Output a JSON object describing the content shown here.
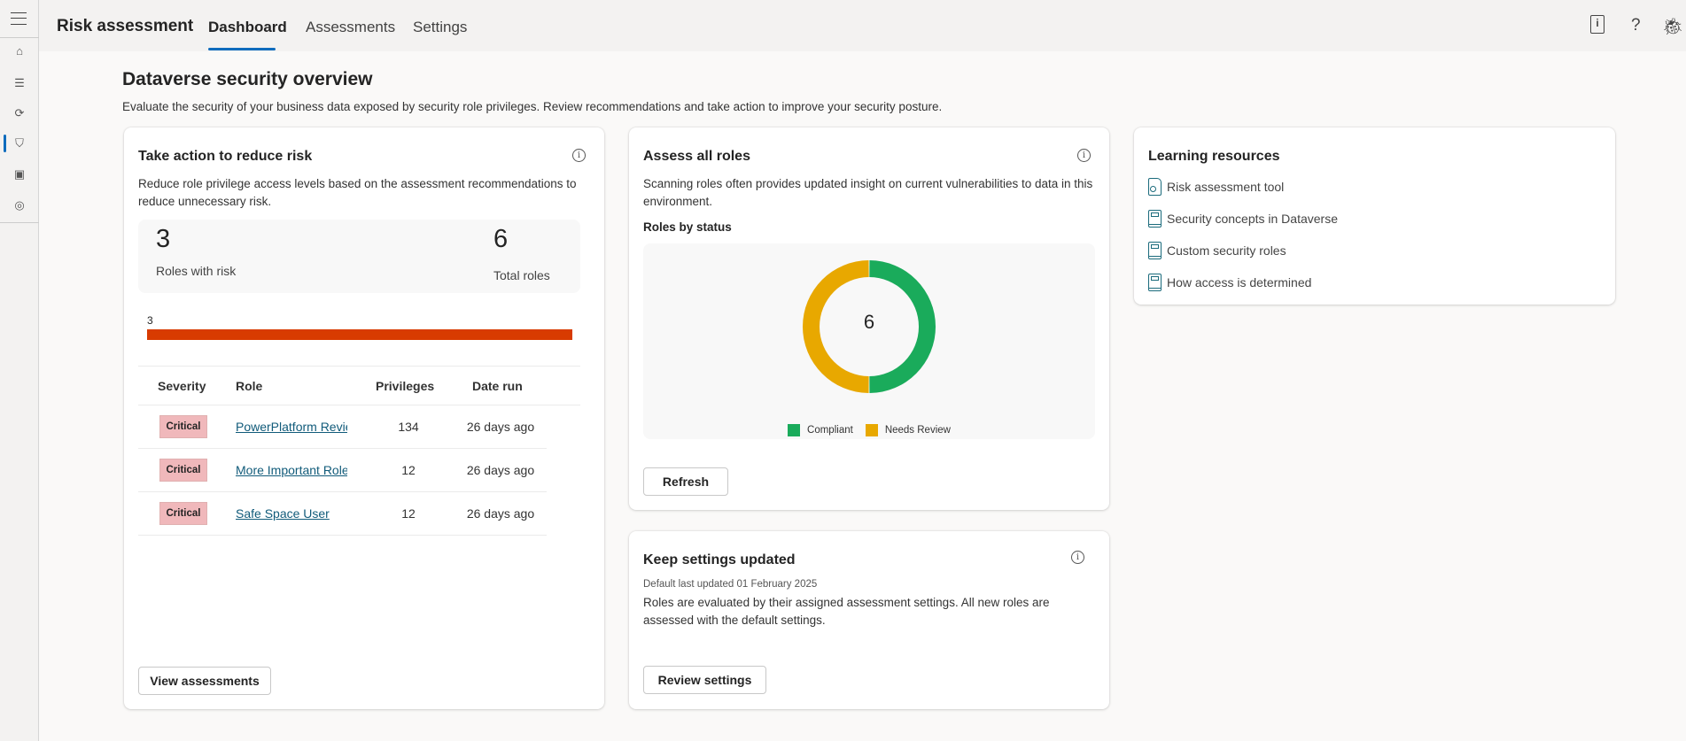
{
  "app": {
    "title": "Risk assessment"
  },
  "tabs": [
    {
      "label": "Dashboard"
    },
    {
      "label": "Assessments"
    },
    {
      "label": "Settings"
    }
  ],
  "header_icons": [
    "book-info-icon",
    "help-icon",
    "bug-icon"
  ],
  "sidebar_icons": [
    "menu-icon",
    "home-icon",
    "filter-list-icon",
    "document-sync-icon",
    "shield-icon",
    "monitor-pulse-icon",
    "broadcast-icon"
  ],
  "page": {
    "title": "Dataverse security overview",
    "description": "Evaluate the security of your business data exposed by security role privileges. Review recommendations and take action to improve your security posture."
  },
  "risk_card": {
    "title": "Take action to reduce risk",
    "description": "Reduce role privilege access levels based on the assessment recommendations to reduce unnecessary risk.",
    "roles_with_risk": "3",
    "roles_with_risk_label": "Roles with risk",
    "total_roles": "6",
    "total_roles_label": "Total roles",
    "bar_label": "3",
    "bar_color": "#d83b01",
    "bar_fraction": 1.0,
    "columns": [
      "Severity",
      "Role",
      "Privileges",
      "Date run"
    ],
    "rows": [
      {
        "severity": "Critical",
        "role": "PowerPlatform Reviewer",
        "privileges": "134",
        "date_run": "26 days ago"
      },
      {
        "severity": "Critical",
        "role": "More Important Role",
        "privileges": "12",
        "date_run": "26 days ago"
      },
      {
        "severity": "Critical",
        "role": "Safe Space User",
        "privileges": "12",
        "date_run": "26 days ago"
      }
    ],
    "button": "View assessments"
  },
  "assess_card": {
    "title": "Assess all roles",
    "description": "Scanning roles often provides updated insight on current vulnerabilities to data in this environment.",
    "chart_title": "Roles by status",
    "button": "Refresh"
  },
  "chart_data": {
    "type": "pie",
    "title": "Roles by status",
    "center_label": "6",
    "categories": [
      "Compliant",
      "Needs Review"
    ],
    "values": [
      3,
      3
    ],
    "colors": [
      "#1aab5b",
      "#e8a800"
    ],
    "legend": "bottom"
  },
  "settings_card": {
    "title": "Keep settings updated",
    "subtitle": "Default last updated 01 February 2025",
    "description": "Roles are evaluated by their assigned assessment settings. All new roles are assessed with the default settings.",
    "button": "Review settings"
  },
  "learning_card": {
    "title": "Learning resources",
    "items": [
      {
        "label": "Risk assessment tool",
        "icon": "certificate-document-icon"
      },
      {
        "label": "Security concepts in Dataverse",
        "icon": "book-icon"
      },
      {
        "label": "Custom security roles",
        "icon": "book-icon"
      },
      {
        "label": "How access is determined",
        "icon": "book-icon"
      }
    ]
  }
}
